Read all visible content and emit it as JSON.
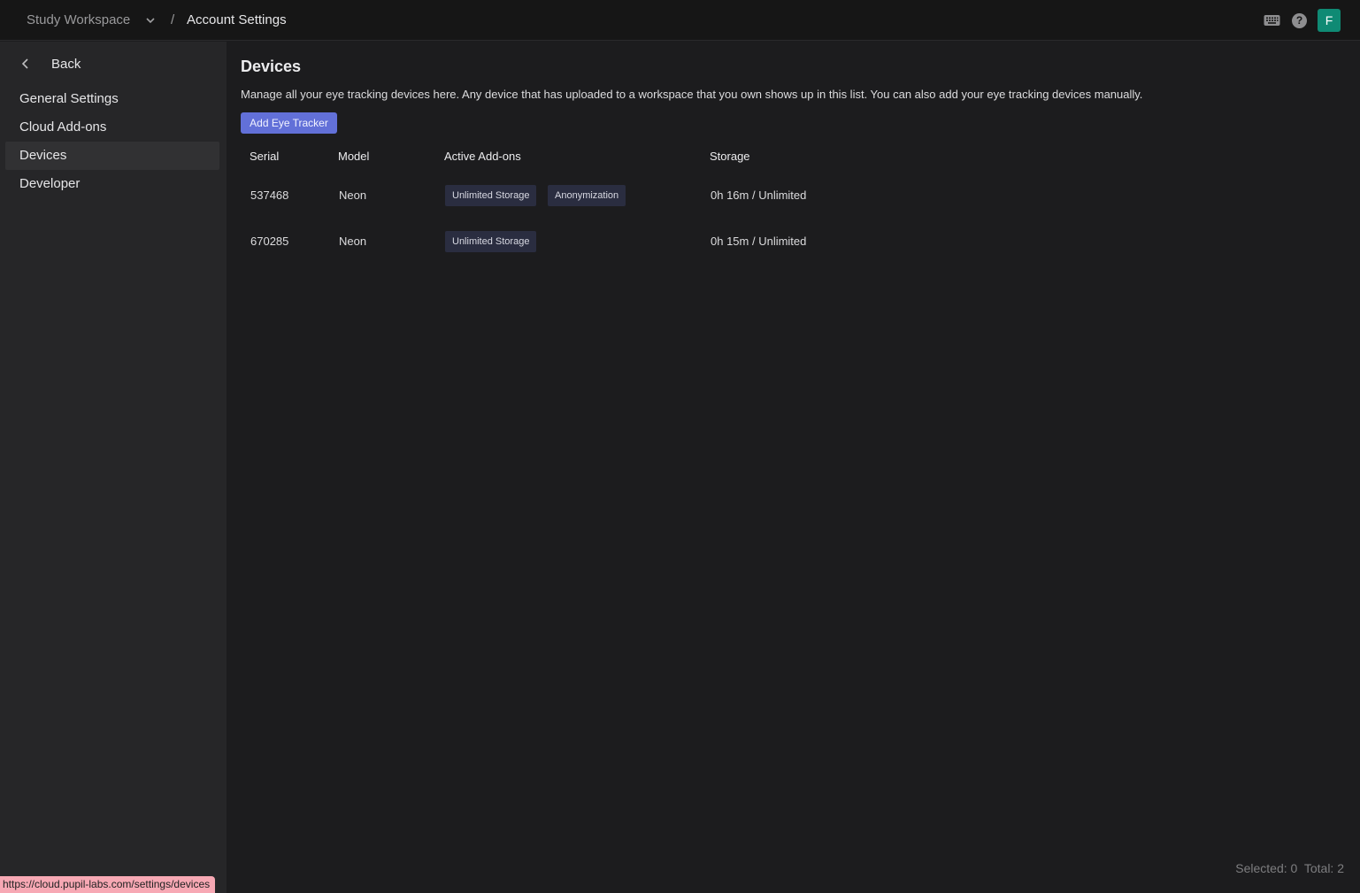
{
  "header": {
    "workspace": "Study Workspace",
    "separator": "/",
    "breadcrumb": "Account Settings",
    "icons": [
      "keyboard-icon",
      "help-icon"
    ],
    "avatar_initial": "F",
    "avatar_color": "#0f8a74"
  },
  "sidebar": {
    "back_label": "Back",
    "items": [
      {
        "label": "General Settings",
        "active": false
      },
      {
        "label": "Cloud Add-ons",
        "active": false
      },
      {
        "label": "Devices",
        "active": true
      },
      {
        "label": "Developer",
        "active": false
      }
    ]
  },
  "main": {
    "title": "Devices",
    "description": "Manage all your eye tracking devices here. Any device that has uploaded to a workspace that you own shows up in this list. You can also add your eye tracking devices manually.",
    "add_button_label": "Add Eye Tracker",
    "accent_color": "#6270d8",
    "table": {
      "columns": [
        "Serial",
        "Model",
        "Active Add-ons",
        "Storage"
      ],
      "rows": [
        {
          "serial": "537468",
          "model": "Neon",
          "addons": [
            "Unlimited Storage",
            "Anonymization"
          ],
          "storage": "0h 16m / Unlimited"
        },
        {
          "serial": "670285",
          "model": "Neon",
          "addons": [
            "Unlimited Storage"
          ],
          "storage": "0h 15m / Unlimited"
        }
      ]
    },
    "footer": {
      "selected_label": "Selected: 0",
      "total_label": "Total: 2"
    }
  },
  "status_bar": {
    "url": "https://cloud.pupil-labs.com/settings/devices"
  }
}
